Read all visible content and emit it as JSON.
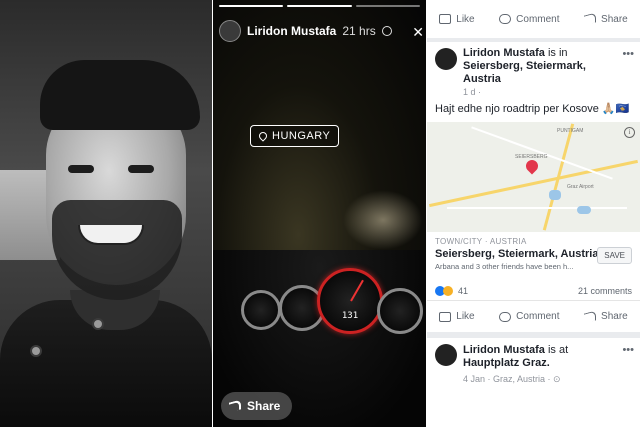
{
  "story": {
    "user_name": "Liridon Mustafa",
    "time": "21 hrs",
    "location_sticker": "HUNGARY",
    "speed_readout": "131",
    "share_label": "Share"
  },
  "feed": {
    "top_actions": {
      "like": "Like",
      "comment": "Comment",
      "share": "Share"
    },
    "post1": {
      "author": "Liridon Mustafa",
      "is_in": "is in",
      "place": "Seiersberg, Steiermark, Austria",
      "meta": "1 d ·",
      "text": "Hajt edhe njo roadtrip per Kosove 🙏🏼🇽🇰",
      "map_labels": [
        "PUNTIGAM",
        "SEIERSBERG",
        "Graz Airport"
      ],
      "place_category": "TOWN/CITY · AUSTRIA",
      "place_name": "Seiersberg, Steiermark, Austria",
      "place_friends": "Arbana and 3 other friends have been h...",
      "save_label": "SAVE",
      "reaction_count": "41",
      "comments": "21 comments",
      "actions": {
        "like": "Like",
        "comment": "Comment",
        "share": "Share"
      }
    },
    "post2": {
      "author": "Liridon Mustafa",
      "is_at": "is at",
      "place": "Hauptplatz Graz.",
      "meta": "4 Jan · Graz, Austria · ⊙"
    }
  },
  "colors": {
    "facebook_blue": "#1877f2",
    "map_pin": "#e2364b",
    "gauge_red": "#cc2222"
  }
}
